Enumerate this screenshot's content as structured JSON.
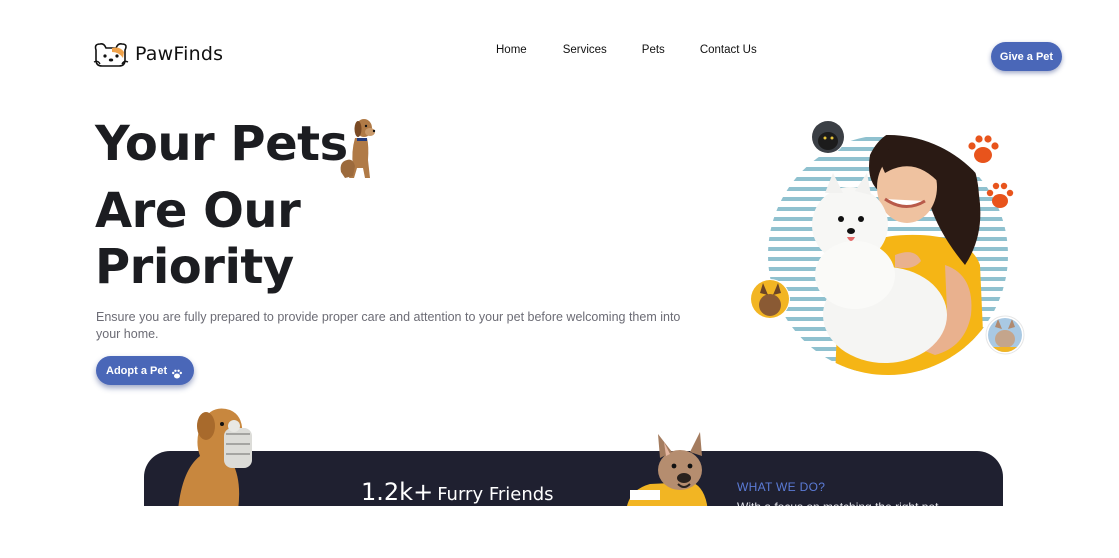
{
  "brand": {
    "name": "PawFinds",
    "logo_icon": "dog-face-icon"
  },
  "nav": {
    "items": [
      "Home",
      "Services",
      "Pets",
      "Contact Us"
    ]
  },
  "header": {
    "cta_label": "Give a Pet",
    "accent_color": "#4a67b8"
  },
  "hero": {
    "title_line1": "Your Pets",
    "title_line2": "Are Our",
    "title_line3": "Priority",
    "description": "Ensure you are fully prepared to provide proper care and attention to your pet before welcoming them into your home.",
    "button_label": "Adopt a Pet",
    "button_icon": "paw-icon",
    "paw_color": "#e8541c"
  },
  "stats": {
    "number": "1.2k+",
    "label": "Furry Friends"
  },
  "what_we_do": {
    "heading": "WHAT WE DO?",
    "text": "With a focus on matching the right pet"
  },
  "colors": {
    "dark_panel": "#1f2030",
    "text_dark": "#1c1d21"
  }
}
